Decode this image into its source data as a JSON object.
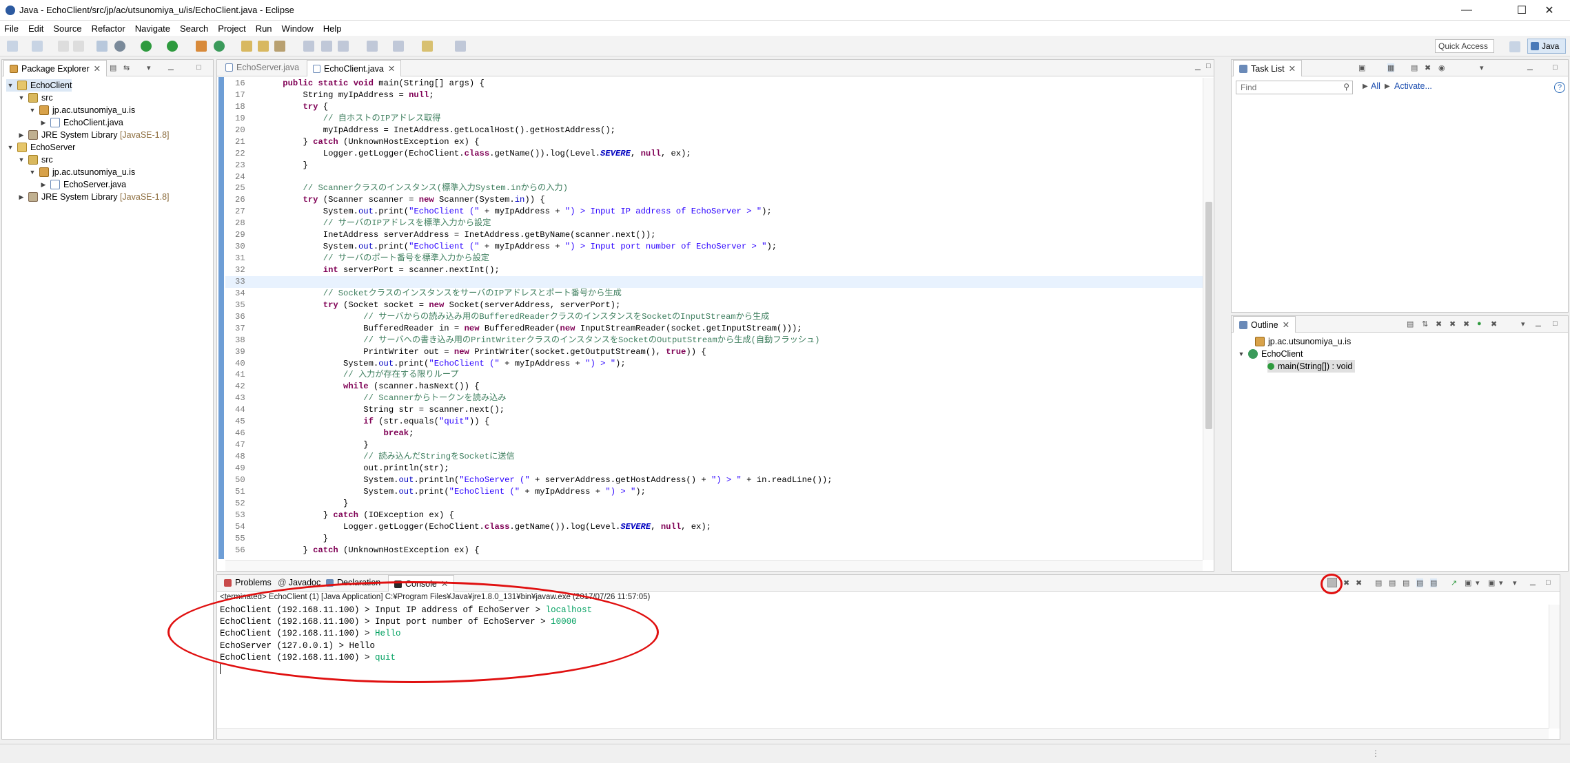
{
  "window": {
    "title": "Java - EchoClient/src/jp/ac/utsunomiya_u/is/EchoClient.java - Eclipse"
  },
  "menu": [
    "File",
    "Edit",
    "Source",
    "Refactor",
    "Navigate",
    "Search",
    "Project",
    "Run",
    "Window",
    "Help"
  ],
  "toolbar": {
    "quick_access": "Quick Access",
    "perspective": "Java"
  },
  "package_explorer": {
    "tab": "Package Explorer",
    "items": [
      {
        "label": "EchoClient",
        "extra": ""
      },
      {
        "label": "src",
        "extra": ""
      },
      {
        "label": "jp.ac.utsunomiya_u.is",
        "extra": ""
      },
      {
        "label": "EchoClient.java",
        "extra": ""
      },
      {
        "label": "JRE System Library",
        "extra": "[JavaSE-1.8]"
      },
      {
        "label": "EchoServer",
        "extra": ""
      },
      {
        "label": "src",
        "extra": ""
      },
      {
        "label": "jp.ac.utsunomiya_u.is",
        "extra": ""
      },
      {
        "label": "EchoServer.java",
        "extra": ""
      },
      {
        "label": "JRE System Library",
        "extra": "[JavaSE-1.8]"
      }
    ]
  },
  "editor": {
    "tabs": [
      "EchoServer.java",
      "EchoClient.java"
    ],
    "lines": [
      {
        "n": "16",
        "text": "    public static void main(String[] args) {"
      },
      {
        "n": "17",
        "text": "        String myIpAddress = null;"
      },
      {
        "n": "18",
        "text": "        try {"
      },
      {
        "n": "19",
        "text": "            // 自ホストのIPアドレス取得"
      },
      {
        "n": "20",
        "text": "            myIpAddress = InetAddress.getLocalHost().getHostAddress();"
      },
      {
        "n": "21",
        "text": "        } catch (UnknownHostException ex) {"
      },
      {
        "n": "22",
        "text": "            Logger.getLogger(EchoClient.class.getName()).log(Level.SEVERE, null, ex);"
      },
      {
        "n": "23",
        "text": "        }"
      },
      {
        "n": "24",
        "text": ""
      },
      {
        "n": "25",
        "text": "        // Scannerクラスのインスタンス(標準入力System.inからの入力)"
      },
      {
        "n": "26",
        "text": "        try (Scanner scanner = new Scanner(System.in)) {"
      },
      {
        "n": "27",
        "text": "            System.out.print(\"EchoClient (\" + myIpAddress + \") > Input IP address of EchoServer > \");"
      },
      {
        "n": "28",
        "text": "            // サーバのIPアドレスを標準入力から設定"
      },
      {
        "n": "29",
        "text": "            InetAddress serverAddress = InetAddress.getByName(scanner.next());"
      },
      {
        "n": "30",
        "text": "            System.out.print(\"EchoClient (\" + myIpAddress + \") > Input port number of EchoServer > \");"
      },
      {
        "n": "31",
        "text": "            // サーバのポート番号を標準入力から設定"
      },
      {
        "n": "32",
        "text": "            int serverPort = scanner.nextInt();"
      },
      {
        "n": "33",
        "text": ""
      },
      {
        "n": "34",
        "text": "            // SocketクラスのインスタンスをサーバのIPアドレスとポート番号から生成"
      },
      {
        "n": "35",
        "text": "            try (Socket socket = new Socket(serverAddress, serverPort);"
      },
      {
        "n": "36",
        "text": "                    // サーバからの読み込み用のBufferedReaderクラスのインスタンスをSocketのInputStreamから生成"
      },
      {
        "n": "37",
        "text": "                    BufferedReader in = new BufferedReader(new InputStreamReader(socket.getInputStream()));"
      },
      {
        "n": "38",
        "text": "                    // サーバへの書き込み用のPrintWriterクラスのインスタンスをSocketのOutputStreamから生成(自動フラッシュ)"
      },
      {
        "n": "39",
        "text": "                    PrintWriter out = new PrintWriter(socket.getOutputStream(), true)) {"
      },
      {
        "n": "40",
        "text": "                System.out.print(\"EchoClient (\" + myIpAddress + \") > \");"
      },
      {
        "n": "41",
        "text": "                // 入力が存在する限りループ"
      },
      {
        "n": "42",
        "text": "                while (scanner.hasNext()) {"
      },
      {
        "n": "43",
        "text": "                    // Scannerからトークンを読み込み"
      },
      {
        "n": "44",
        "text": "                    String str = scanner.next();"
      },
      {
        "n": "45",
        "text": "                    if (str.equals(\"quit\")) {"
      },
      {
        "n": "46",
        "text": "                        break;"
      },
      {
        "n": "47",
        "text": "                    }"
      },
      {
        "n": "48",
        "text": "                    // 読み込んだStringをSocketに送信"
      },
      {
        "n": "49",
        "text": "                    out.println(str);"
      },
      {
        "n": "50",
        "text": "                    System.out.println(\"EchoServer (\" + serverAddress.getHostAddress() + \") > \" + in.readLine());"
      },
      {
        "n": "51",
        "text": "                    System.out.print(\"EchoClient (\" + myIpAddress + \") > \");"
      },
      {
        "n": "52",
        "text": "                }"
      },
      {
        "n": "53",
        "text": "            } catch (IOException ex) {"
      },
      {
        "n": "54",
        "text": "                Logger.getLogger(EchoClient.class.getName()).log(Level.SEVERE, null, ex);"
      },
      {
        "n": "55",
        "text": "            }"
      },
      {
        "n": "56",
        "text": "        } catch (UnknownHostException ex) {"
      }
    ]
  },
  "task_list": {
    "tab": "Task List",
    "find_placeholder": "Find",
    "all": "All",
    "activate": "Activate..."
  },
  "outline": {
    "tab": "Outline",
    "items": [
      "jp.ac.utsunomiya_u.is",
      "EchoClient",
      "main(String[]) : void"
    ]
  },
  "console": {
    "tabs": [
      "Problems",
      "Javadoc",
      "Declaration",
      "Console"
    ],
    "status": "<terminated> EchoClient (1) [Java Application] C:¥Program Files¥Java¥jre1.8.0_131¥bin¥javaw.exe (2017/07/26 11:57:05)",
    "lines": [
      {
        "prefix": "EchoClient (192.168.11.100) > Input IP address of EchoServer > ",
        "input": "localhost"
      },
      {
        "prefix": "EchoClient (192.168.11.100) > Input port number of EchoServer > ",
        "input": "10000"
      },
      {
        "prefix": "EchoClient (192.168.11.100) > ",
        "input": "Hello"
      },
      {
        "prefix": "EchoServer (127.0.0.1) > Hello",
        "input": ""
      },
      {
        "prefix": "EchoClient (192.168.11.100) > ",
        "input": "quit"
      }
    ]
  },
  "colors": {
    "annotation": "#e01010",
    "keyword": "#7f0055",
    "comment": "#3f7f5f",
    "string": "#2a00ff",
    "console_input": "#00a060"
  }
}
